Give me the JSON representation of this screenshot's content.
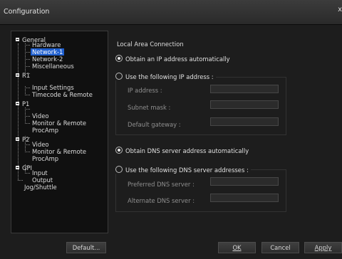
{
  "window": {
    "title": "Configuration",
    "close_glyph": "x"
  },
  "tree": {
    "general": "General",
    "hardware": "Hardware",
    "network1": "Network-1",
    "network2": "Network-2",
    "misc": "Miscellaneous",
    "r1": "R1",
    "input_settings": "Input Settings",
    "timecode": "Timecode & Remote",
    "p1": "P1",
    "p1_video": "Video",
    "p1_monitor": "Monitor & Remote",
    "p1_procamp": "ProcAmp",
    "p2": "P2",
    "p2_video": "Video",
    "p2_monitor": "Monitor & Remote",
    "p2_procamp": "ProcAmp",
    "gpi": "GPI",
    "gpi_input": "Input",
    "gpi_output": "Output",
    "jog": "Jog/Shuttle"
  },
  "panel": {
    "section_title": "Local Area Connection",
    "ip_auto_label": "Obtain an IP address automatically",
    "ip_manual_label": "Use the following IP address :",
    "ip_address_label": "IP address :",
    "subnet_label": "Subnet mask :",
    "gateway_label": "Default gateway :",
    "dns_auto_label": "Obtain DNS server address automatically",
    "dns_manual_label": "Use the following DNS server addresses :",
    "preferred_dns_label": "Preferred DNS server :",
    "alternate_dns_label": "Alternate DNS server :",
    "ip_address_value": "",
    "subnet_value": "",
    "gateway_value": "",
    "preferred_dns_value": "",
    "alternate_dns_value": ""
  },
  "buttons": {
    "default": "Default...",
    "ok": "OK",
    "cancel": "Cancel",
    "apply": "Apply"
  }
}
